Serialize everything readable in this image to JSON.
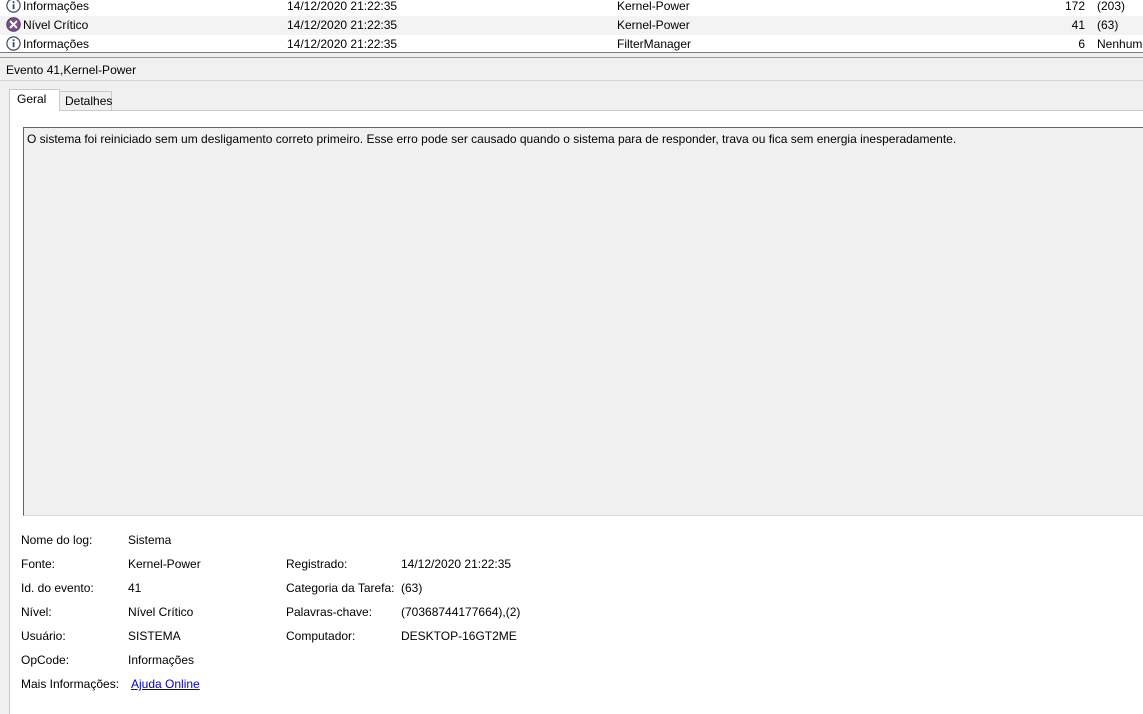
{
  "event_list": {
    "rows": [
      {
        "level": "Informações",
        "icon": "info-icon",
        "date": "14/12/2020 21:22:35",
        "source": "Kernel-Power",
        "event_id": "172",
        "category": "(203)"
      },
      {
        "level": "Nível Crítico",
        "icon": "critical-icon",
        "date": "14/12/2020 21:22:35",
        "source": "Kernel-Power",
        "event_id": "41",
        "category": "(63)"
      },
      {
        "level": "Informações",
        "icon": "info-icon",
        "date": "14/12/2020 21:22:35",
        "source": "FilterManager",
        "event_id": "6",
        "category": "Nenhum"
      }
    ]
  },
  "details": {
    "title": "Evento 41,Kernel-Power",
    "tabs": {
      "general": "Geral",
      "details": "Detalhes"
    },
    "description": "O sistema foi reiniciado sem um desligamento correto primeiro. Esse erro pode ser causado quando o sistema para de responder, trava ou fica sem energia inesperadamente.",
    "properties": {
      "log_name_label": "Nome do log:",
      "log_name": "Sistema",
      "source_label": "Fonte:",
      "source": "Kernel-Power",
      "event_id_label": "Id. do evento:",
      "event_id": "41",
      "level_label": "Nível:",
      "level": "Nível Crítico",
      "user_label": "Usuário:",
      "user": "SISTEMA",
      "opcode_label": "OpCode:",
      "opcode": "Informações",
      "more_info_label": "Mais Informações:",
      "more_info_link": "Ajuda Online",
      "logged_label": "Registrado:",
      "logged": "14/12/2020 21:22:35",
      "task_category_label": "Categoria da Tarefa:",
      "task_category": "(63)",
      "keywords_label": "Palavras-chave:",
      "keywords": "(70368744177664),(2)",
      "computer_label": "Computador:",
      "computer": "DESKTOP-16GT2ME"
    }
  },
  "colors": {
    "link": "#0000cc",
    "critical_icon": "#7a4e8a",
    "info_icon": "#3a4a6a"
  }
}
